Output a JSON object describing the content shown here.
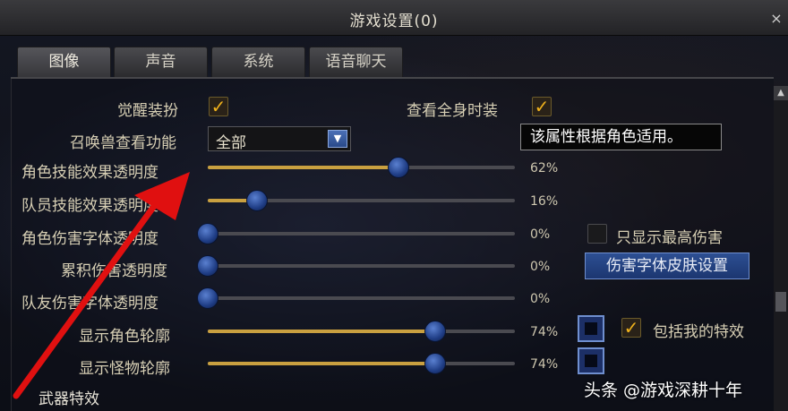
{
  "window": {
    "title": "游戏设置(0)",
    "close_glyph": "×"
  },
  "tabs": [
    {
      "label": "图像",
      "active": true
    },
    {
      "label": "声音",
      "active": false
    },
    {
      "label": "系统",
      "active": false
    },
    {
      "label": "语音聊天",
      "active": false
    }
  ],
  "checks": {
    "awaken_outfit": {
      "label": "觉醒装扮",
      "checked": true
    },
    "view_full_costume": {
      "label": "查看全身时装",
      "checked": true
    },
    "show_max_damage": {
      "label": "只显示最高伤害",
      "checked": false
    },
    "include_my_effects": {
      "label": "包括我的特效",
      "checked": true
    }
  },
  "summon_view": {
    "label": "召唤兽查看功能",
    "value": "全部"
  },
  "tooltip": "该属性根据角色适用。",
  "sliders": [
    {
      "label": "角色技能效果透明度",
      "value": 62,
      "display": "62%"
    },
    {
      "label": "队员技能效果透明度",
      "value": 16,
      "display": "16%"
    },
    {
      "label": "角色伤害字体透明度",
      "value": 0,
      "display": "0%"
    },
    {
      "label": "累积伤害透明度",
      "value": 0,
      "display": "0%"
    },
    {
      "label": "队友伤害字体透明度",
      "value": 0,
      "display": "0%"
    },
    {
      "label": "显示角色轮廓",
      "value": 74,
      "display": "74%"
    },
    {
      "label": "显示怪物轮廓",
      "value": 74,
      "display": "74%"
    }
  ],
  "damage_skin_button": "伤害字体皮肤设置",
  "weapon_effects_label": "武器特效",
  "watermark": "头条 @游戏深耕十年",
  "colors": {
    "accent_gold": "#f0b21c",
    "knob_blue": "#2a4fa8",
    "arrow_red": "#e01010"
  }
}
